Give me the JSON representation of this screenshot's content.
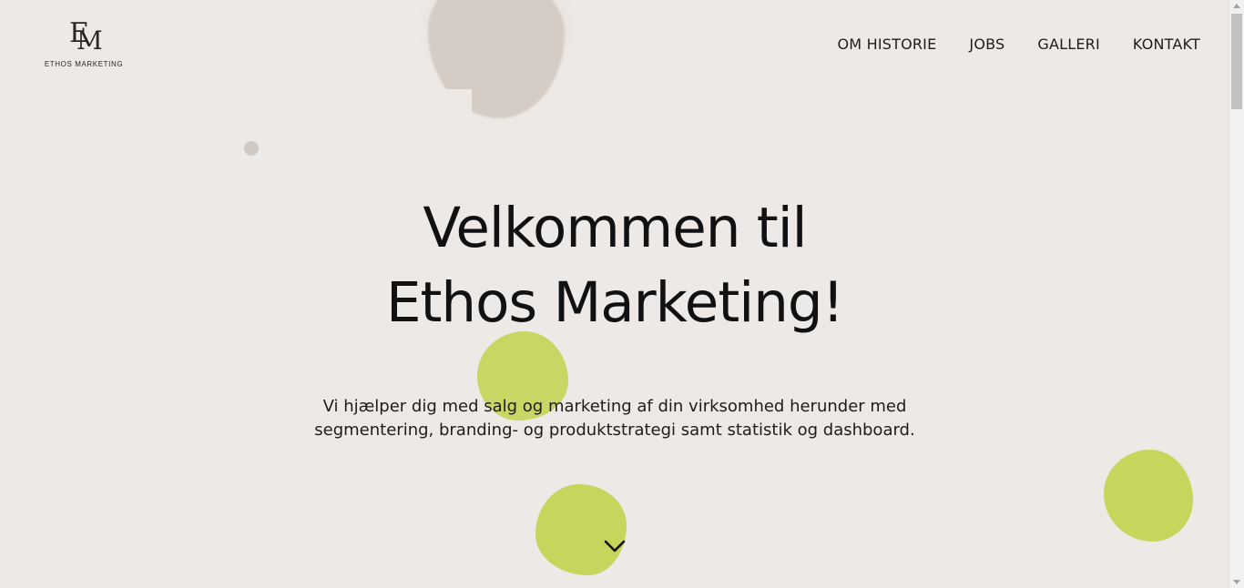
{
  "logo": {
    "mark_letters": [
      "E",
      "M"
    ],
    "text": "ETHOS MARKETING"
  },
  "nav": {
    "items": [
      {
        "label": "OM HISTORIE"
      },
      {
        "label": "JOBS"
      },
      {
        "label": "GALLERI"
      },
      {
        "label": "KONTAKT"
      }
    ]
  },
  "hero": {
    "title_lines": [
      "Velkommen til",
      "Ethos Marketing!"
    ],
    "subtitle_lines": [
      "Vi hjælper dig med salg og marketing af din virksomhed herunder med",
      "segmentering, branding- og produktstrategi samt statistik og dashboard."
    ],
    "scroll_icon": "chevron-down-icon"
  },
  "colors": {
    "background": "#ede9e7",
    "accent_green": "#c6d65c",
    "accent_beige": "#d4ccc5",
    "text": "#111111"
  }
}
